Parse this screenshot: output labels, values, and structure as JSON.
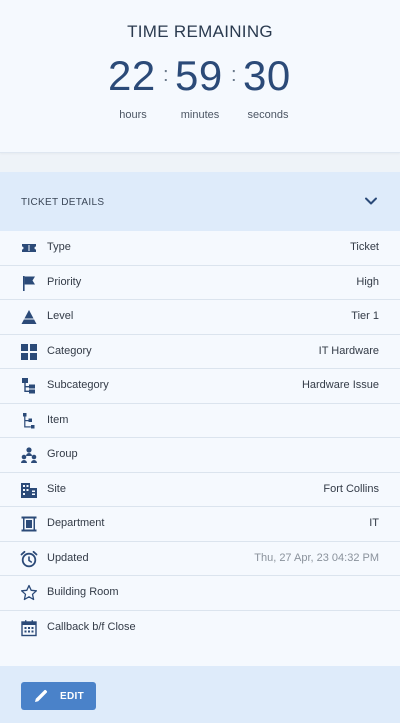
{
  "timer": {
    "title": "TIME REMAINING",
    "hours": "22",
    "minutes": "59",
    "seconds": "30",
    "separator": ":",
    "hours_label": "hours",
    "minutes_label": "minutes",
    "seconds_label": "seconds"
  },
  "details": {
    "header_label": "TICKET DETAILS",
    "rows": [
      {
        "icon": "ticket-icon",
        "label": "Type",
        "value": "Ticket"
      },
      {
        "icon": "flag-icon",
        "label": "Priority",
        "value": "High"
      },
      {
        "icon": "triangle-level-icon",
        "label": "Level",
        "value": "Tier 1"
      },
      {
        "icon": "category-grid-icon",
        "label": "Category",
        "value": "IT Hardware"
      },
      {
        "icon": "subcategory-tree-icon",
        "label": "Subcategory",
        "value": "Hardware Issue"
      },
      {
        "icon": "item-tree-icon",
        "label": "Item",
        "value": ""
      },
      {
        "icon": "group-people-icon",
        "label": "Group",
        "value": ""
      },
      {
        "icon": "building-icon",
        "label": "Site",
        "value": "Fort Collins"
      },
      {
        "icon": "department-icon",
        "label": "Department",
        "value": "IT"
      },
      {
        "icon": "alarm-clock-icon",
        "label": "Updated",
        "value": "Thu, 27 Apr, 23 04:32 PM"
      },
      {
        "icon": "star-outline-icon",
        "label": "Building Room",
        "value": ""
      },
      {
        "icon": "calendar-icon",
        "label": "Callback b/f Close",
        "value": ""
      }
    ]
  },
  "footer": {
    "edit_label": "EDIT"
  },
  "colors": {
    "accent": "#4a82c9",
    "digits": "#2b4a78",
    "icon": "#2b4a78",
    "header_bg": "#deebfa"
  }
}
